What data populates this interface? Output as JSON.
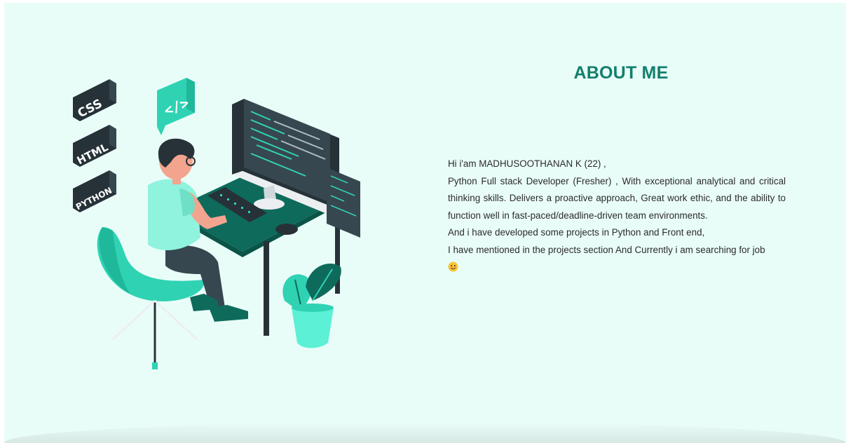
{
  "about": {
    "title": "ABOUT ME",
    "bio": {
      "greeting": "Hi i'am MADHUSOOTHANAN K (22) ,",
      "paragraph": "Python Full stack Developer (Fresher) , With exceptional analytical and critical thinking skills. Delivers a proactive approach, Great work ethic, and the ability to function well in fast-paced/deadline-driven team environments.",
      "projects_line": "And i have developed some projects in Python and Front end,",
      "mention_line": "I have mentioned in the projects section And Currently i am searching for job",
      "emoji_icon": "smiling-face-icon"
    }
  },
  "illustration": {
    "badges": [
      "CSS",
      "HTML",
      "PYTHON"
    ],
    "code_tag": "</>",
    "colors": {
      "accent": "#2fd3b4",
      "dark": "#263238",
      "teal_dark": "#0e6b5c",
      "skin": "#f3a48f"
    }
  },
  "colors": {
    "background": "#e9fdf8",
    "title": "#137f6d",
    "text": "#2b2b2b"
  }
}
